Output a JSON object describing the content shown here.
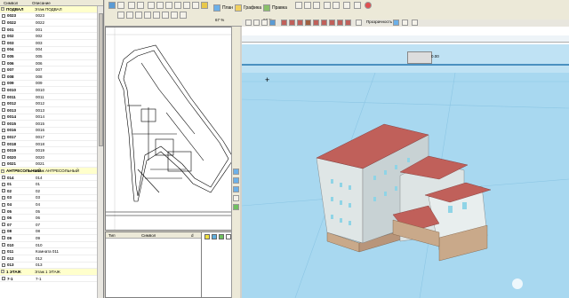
{
  "tree": {
    "col_symbol": "Символ",
    "col_description": "Описание",
    "rows": [
      {
        "sym": "ПОДВАЛ",
        "desc": "Этаж ПОДВАЛ",
        "group": true
      },
      {
        "sym": "0023",
        "desc": "0023"
      },
      {
        "sym": "0022",
        "desc": "0022"
      },
      {
        "sym": "001",
        "desc": "001"
      },
      {
        "sym": "002",
        "desc": "002"
      },
      {
        "sym": "003",
        "desc": "003"
      },
      {
        "sym": "004",
        "desc": "004"
      },
      {
        "sym": "005",
        "desc": "005"
      },
      {
        "sym": "006",
        "desc": "006"
      },
      {
        "sym": "007",
        "desc": "007"
      },
      {
        "sym": "008",
        "desc": "008"
      },
      {
        "sym": "009",
        "desc": "009"
      },
      {
        "sym": "0010",
        "desc": "0010"
      },
      {
        "sym": "0011",
        "desc": "0011"
      },
      {
        "sym": "0012",
        "desc": "0012"
      },
      {
        "sym": "0013",
        "desc": "0013"
      },
      {
        "sym": "0014",
        "desc": "0014"
      },
      {
        "sym": "0015",
        "desc": "0015"
      },
      {
        "sym": "0016",
        "desc": "0016"
      },
      {
        "sym": "0017",
        "desc": "0017"
      },
      {
        "sym": "0018",
        "desc": "0018"
      },
      {
        "sym": "0019",
        "desc": "0019"
      },
      {
        "sym": "0020",
        "desc": "0020"
      },
      {
        "sym": "0021",
        "desc": "0021"
      },
      {
        "sym": "АНТРЕСОЛЬНЫЙ",
        "desc": "Этаж АНТРЕСОЛЬНЫЙ",
        "group": true
      },
      {
        "sym": "014",
        "desc": "014"
      },
      {
        "sym": "01",
        "desc": "01"
      },
      {
        "sym": "02",
        "desc": "02"
      },
      {
        "sym": "03",
        "desc": "03"
      },
      {
        "sym": "04",
        "desc": "04"
      },
      {
        "sym": "05",
        "desc": "05"
      },
      {
        "sym": "06",
        "desc": "06"
      },
      {
        "sym": "07",
        "desc": "07"
      },
      {
        "sym": "08",
        "desc": "08"
      },
      {
        "sym": "09",
        "desc": "09"
      },
      {
        "sym": "010",
        "desc": "010"
      },
      {
        "sym": "011",
        "desc": "Комната 011"
      },
      {
        "sym": "012",
        "desc": "012"
      },
      {
        "sym": "013",
        "desc": "013"
      },
      {
        "sym": "1 ЭТАЖ",
        "desc": "Этаж 1 ЭТАЖ",
        "group": true
      },
      {
        "sym": "7-1",
        "desc": "7-1"
      }
    ]
  },
  "toolbar": {
    "tab_plan": "План",
    "tab_graphics": "Графика",
    "tab_edit": "Правка",
    "zoom_plan": "67 %",
    "zoom_small": "67 %",
    "transparency_label": "Прозрачность"
  },
  "ruler3d": {
    "value": "0.00"
  },
  "props": {
    "col_type": "Тип",
    "col_symbol": "Символ",
    "col_d": "d"
  },
  "colors": {
    "sky": "#a8d8f0",
    "facade": "#dfe6e6",
    "roof": "#c0605a",
    "base": "#c9a98a",
    "window": "#8fd4e6"
  }
}
